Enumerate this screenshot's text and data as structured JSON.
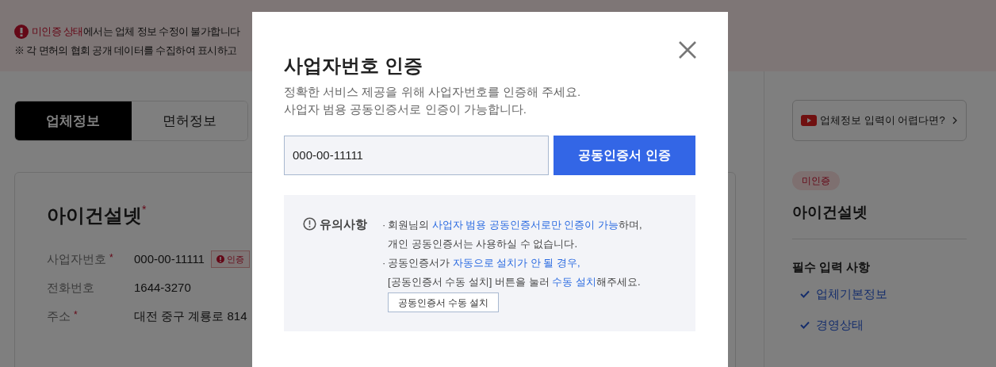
{
  "banner": {
    "lines": [
      "**미인증 상태**에서는 업체 정보 수정이 불가합니다",
      "※ 각 면허의 협회 공개 데이터를 수집하여 표시하고"
    ]
  },
  "tabs": [
    {
      "label": "업체정보",
      "selected": true
    },
    {
      "label": "면허정보",
      "selected": false
    }
  ],
  "company_card": {
    "name": "아이건설넷",
    "name_mark": "*",
    "fields": [
      {
        "label": "사업자번호",
        "mark": "*",
        "value": "000-00-11111",
        "badge": "인증"
      },
      {
        "label": "전화번호",
        "value": "1644-3270"
      },
      {
        "label": "주소",
        "mark": "*",
        "value": "대전 중구 계룡로 814"
      }
    ]
  },
  "sidebar": {
    "video_link": "업체정보 입력이 어렵다면?",
    "status_badge": "미인증",
    "company": "아이건설넷",
    "section_title": "필수 입력 사항",
    "items": [
      {
        "label": "업체기본정보",
        "checked": true
      },
      {
        "label": "경영상태",
        "checked": true
      }
    ]
  },
  "modal": {
    "title": "사업자번호 인증",
    "description": [
      "정확한 서비스 제공을 위해 사업자번호를 인증해 주세요.",
      "사업자 범용 공동인증서로 인증이 가능합니다."
    ],
    "input": {
      "value": "000-00-11111"
    },
    "submit_button": "공동인증서 인증",
    "notice": {
      "title": "유의사항",
      "items": [
        {
          "bullet": "·",
          "lines": [
            "회원님의 **사업자 범용 공동인증서로만 인증이 가능**하며,",
            "개인 공동인증서는 사용하실 수 없습니다."
          ]
        },
        {
          "bullet": "·",
          "lines": [
            "공동인증서가 **자동으로 설치가 안 될 경우,**",
            "[공동인증서 수동 설치] 버튼을 눌러 **수동 설치**해주세요."
          ]
        }
      ],
      "install_button": "공동인증서 수동 설치"
    }
  }
}
